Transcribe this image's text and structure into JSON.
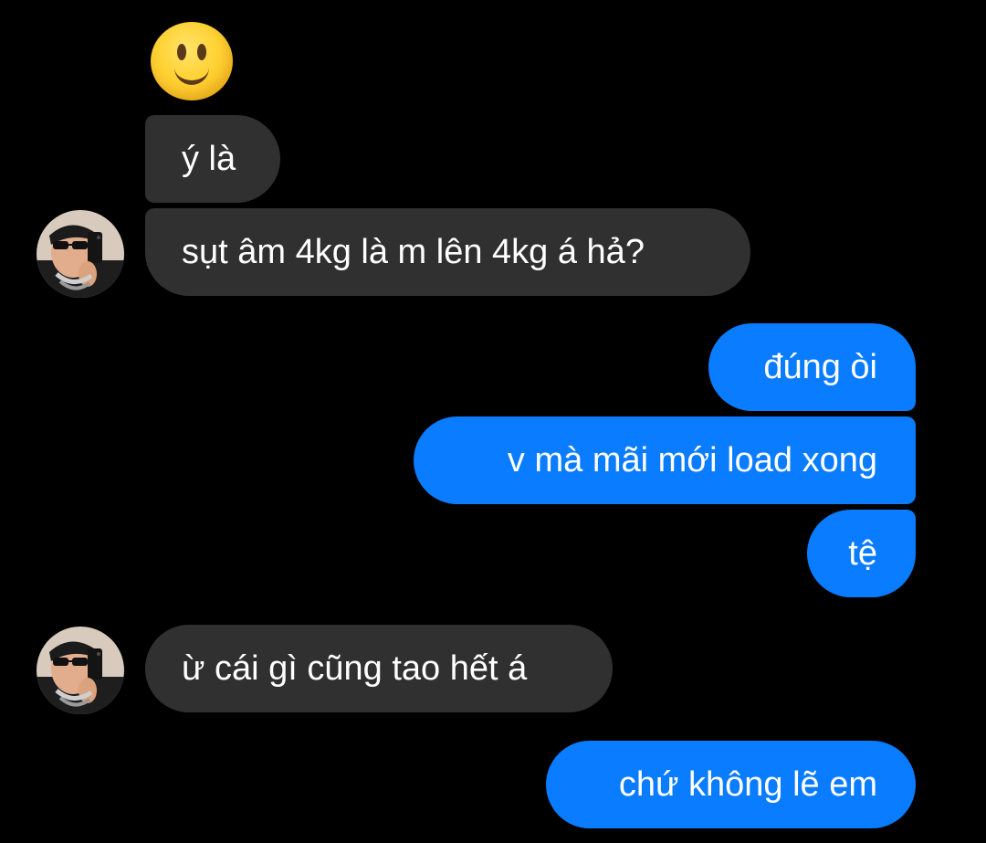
{
  "emoji": {
    "icon": "slightly-smiling-face-icon",
    "color": "#ffd233"
  },
  "colors": {
    "background": "#000000",
    "incoming_bubble": "#303030",
    "outgoing_bubble": "#0a7cff",
    "text": "#ffffff"
  },
  "messages": [
    {
      "direction": "incoming",
      "text": "ý là"
    },
    {
      "direction": "incoming",
      "text": "sụt âm 4kg là m lên 4kg á hả?"
    },
    {
      "direction": "outgoing",
      "text": "đúng òi"
    },
    {
      "direction": "outgoing",
      "text": "v mà mãi mới load xong"
    },
    {
      "direction": "outgoing",
      "text": "tệ"
    },
    {
      "direction": "incoming",
      "text": "ừ cái gì cũng tao hết á"
    },
    {
      "direction": "outgoing",
      "text": "chứ không lẽ em"
    }
  ]
}
